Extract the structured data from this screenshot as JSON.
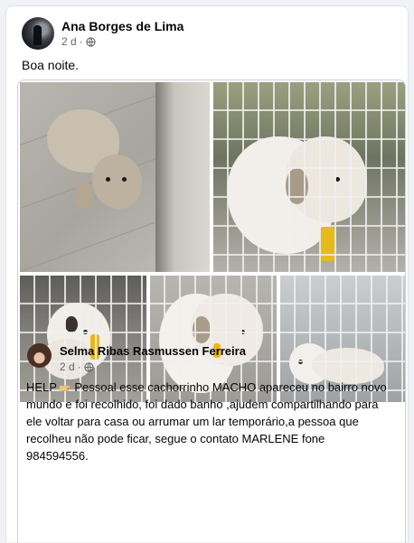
{
  "post": {
    "author": "Ana Borges de Lima",
    "time": "2 d",
    "separator": "·",
    "privacy_icon": "globe-icon",
    "text": "Boa noite."
  },
  "shared_post": {
    "author": "Selma Ribas Rasmussen Ferreira",
    "time": "2 d",
    "separator": "·",
    "privacy_icon": "globe-icon",
    "text_lead": "HELP ",
    "emoji_icon": "pointing-hand-icon",
    "text_body": "Pessoal esse cachorrinho MACHO apareceu no bairro novo mundo e foi recolhido, foi dado banho ,ajudem compartilhando para ele voltar para casa ou arrumar um lar temporário,a pessoa que recolheu não pode ficar, segue o contato MARLENE fone 984594556.",
    "photos": [
      "dog-photo-1",
      "dog-photo-2",
      "dog-photo-3",
      "dog-photo-4",
      "dog-photo-5"
    ]
  },
  "colors": {
    "background": "#f0f2f5",
    "card": "#ffffff",
    "secondary_text": "#65676b"
  }
}
